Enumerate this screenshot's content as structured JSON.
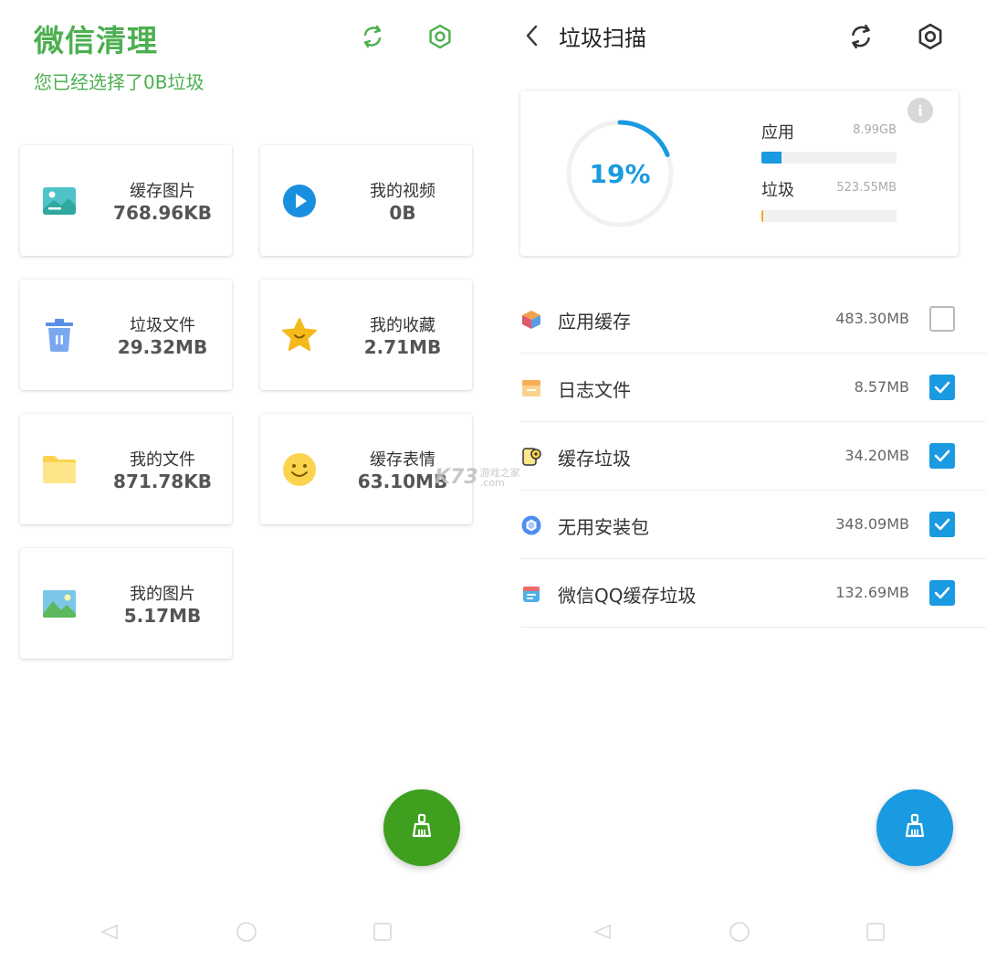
{
  "left": {
    "title": "微信清理",
    "subtitle": "您已经选择了0B垃圾",
    "accent": "#4caf50",
    "cards": [
      {
        "name": "缓存图片",
        "size": "768.96KB",
        "icon": "image-icon"
      },
      {
        "name": "我的视频",
        "size": "0B",
        "icon": "play-icon"
      },
      {
        "name": "垃圾文件",
        "size": "29.32MB",
        "icon": "trash-icon"
      },
      {
        "name": "我的收藏",
        "size": "2.71MB",
        "icon": "star-icon"
      },
      {
        "name": "我的文件",
        "size": "871.78KB",
        "icon": "folder-icon"
      },
      {
        "name": "缓存表情",
        "size": "63.10MB",
        "icon": "smiley-icon"
      },
      {
        "name": "我的图片",
        "size": "5.17MB",
        "icon": "picture-icon"
      }
    ],
    "fab_color": "#3f9f1f"
  },
  "right": {
    "title": "垃圾扫描",
    "percent": "19%",
    "percent_value": 0.19,
    "accent": "#1a9ae0",
    "summary": [
      {
        "label": "应用",
        "value": "8.99GB",
        "fill": 0.15,
        "color": "#1a9ae0"
      },
      {
        "label": "垃圾",
        "value": "523.55MB",
        "fill": 0.01,
        "color": "#f5a623"
      }
    ],
    "info_badge": "i",
    "items": [
      {
        "name": "应用缓存",
        "size": "483.30MB",
        "checked": false,
        "icon": "cube-icon"
      },
      {
        "name": "日志文件",
        "size": "8.57MB",
        "checked": true,
        "icon": "log-box-icon"
      },
      {
        "name": "缓存垃圾",
        "size": "34.20MB",
        "checked": true,
        "icon": "paper-roll-icon"
      },
      {
        "name": "无用安装包",
        "size": "348.09MB",
        "checked": true,
        "icon": "package-icon"
      },
      {
        "name": "微信QQ缓存垃圾",
        "size": "132.69MB",
        "checked": true,
        "icon": "chat-cache-icon"
      }
    ]
  },
  "watermark": {
    "brand": "K73",
    "sub1": "游戏之家",
    "sub2": ".com"
  }
}
